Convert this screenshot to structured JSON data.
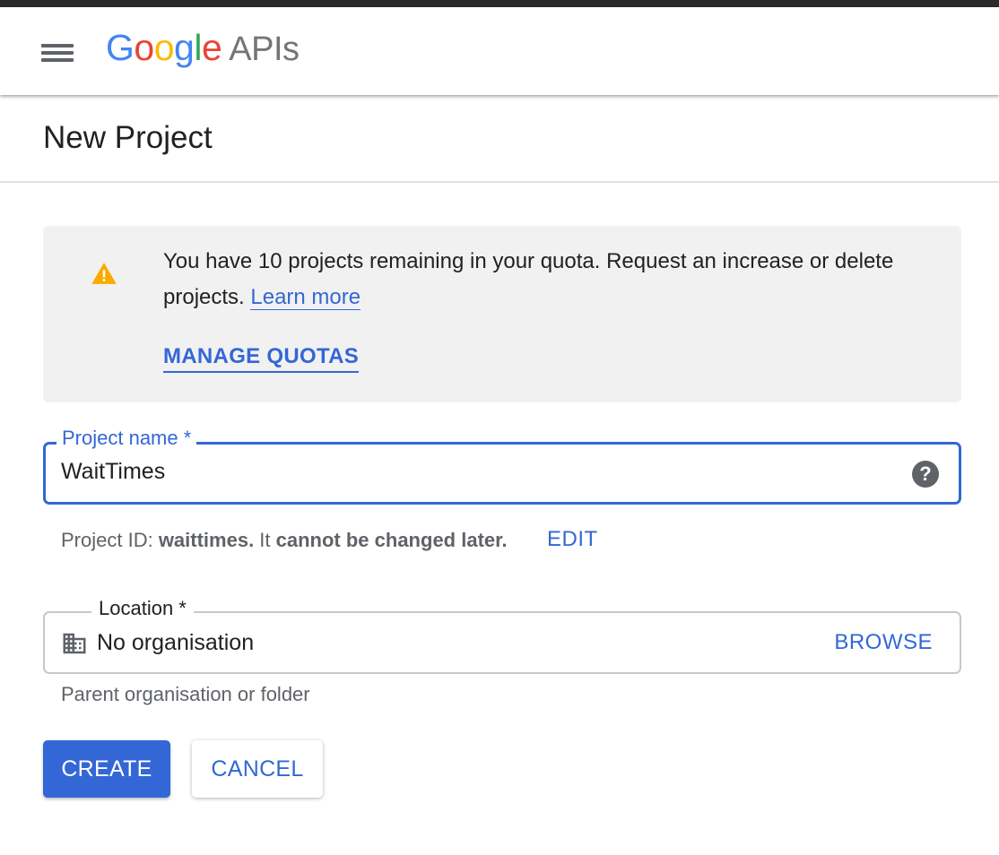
{
  "header": {
    "logo_letters": [
      {
        "char": "G",
        "color": "#4285F4"
      },
      {
        "char": "o",
        "color": "#EA4335"
      },
      {
        "char": "o",
        "color": "#FBBC05"
      },
      {
        "char": "g",
        "color": "#4285F4"
      },
      {
        "char": "l",
        "color": "#34A853"
      },
      {
        "char": "e",
        "color": "#EA4335"
      }
    ],
    "logo_suffix": "APIs",
    "menu_icon": "hamburger-menu-icon"
  },
  "page": {
    "title": "New Project"
  },
  "quota": {
    "icon": "warning-icon",
    "message": "You have 10 projects remaining in your quota. Request an increase or delete projects.",
    "learn_more": "Learn more",
    "manage_quotas": "MANAGE QUOTAS"
  },
  "project_name": {
    "label": "Project name *",
    "value": "WaitTimes",
    "help_icon": "help-icon"
  },
  "project_id": {
    "prefix": "Project ID: ",
    "id": "waittimes.",
    "middle": " It ",
    "suffix": "cannot be changed later.",
    "edit": "EDIT"
  },
  "location": {
    "label": "Location *",
    "value": "No organisation",
    "icon": "building-icon",
    "browse": "BROWSE",
    "helper": "Parent organisation or folder"
  },
  "actions": {
    "create": "CREATE",
    "cancel": "CANCEL"
  },
  "colors": {
    "accent": "#3367d6",
    "warning": "#f9ab00"
  }
}
